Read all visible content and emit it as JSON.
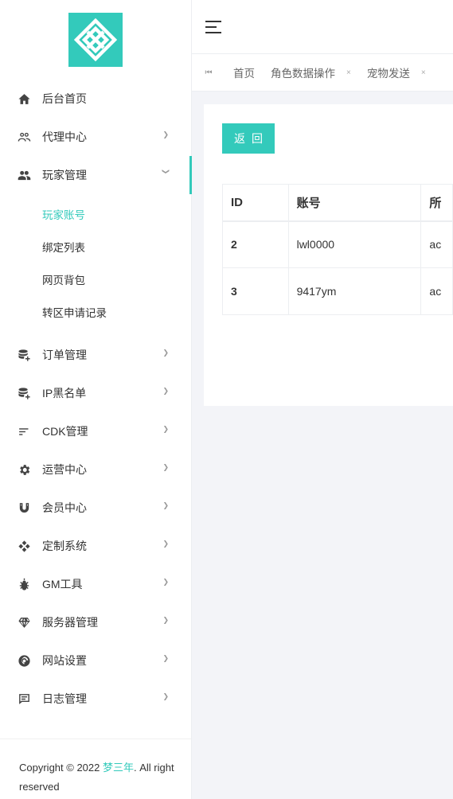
{
  "colors": {
    "accent": "#33cabb",
    "background": "#f3f4f8"
  },
  "sidebar": {
    "items": [
      {
        "label": "后台首页",
        "icon": "home-icon"
      },
      {
        "label": "代理中心",
        "icon": "agents-icon"
      },
      {
        "label": "玩家管理",
        "icon": "users-icon"
      },
      {
        "label": "订单管理",
        "icon": "database-plus-icon"
      },
      {
        "label": "IP黑名单",
        "icon": "database-plus-icon"
      },
      {
        "label": "CDK管理",
        "icon": "sort-icon"
      },
      {
        "label": "运营中心",
        "icon": "gear-icon"
      },
      {
        "label": "会员中心",
        "icon": "magnet-icon"
      },
      {
        "label": "定制系统",
        "icon": "gamepad-icon"
      },
      {
        "label": "GM工具",
        "icon": "bug-icon"
      },
      {
        "label": "服务器管理",
        "icon": "diamond-icon"
      },
      {
        "label": "网站设置",
        "icon": "web-icon"
      },
      {
        "label": "日志管理",
        "icon": "message-icon"
      }
    ],
    "submenu": [
      "玩家账号",
      "绑定列表",
      "网页背包",
      "转区申请记录"
    ]
  },
  "copyright": {
    "prefix": "Copyright © 2022 ",
    "brand": "梦三年",
    "suffix": ". All right reserved"
  },
  "tabs": [
    {
      "label": "首页"
    },
    {
      "label": "角色数据操作"
    },
    {
      "label": "宠物发送"
    }
  ],
  "content": {
    "back_button": "返回",
    "table": {
      "headers": [
        "ID",
        "账号",
        "所"
      ],
      "rows": [
        [
          "2",
          "lwl0000",
          "ac"
        ],
        [
          "3",
          "9417ym",
          "ac"
        ]
      ]
    }
  }
}
